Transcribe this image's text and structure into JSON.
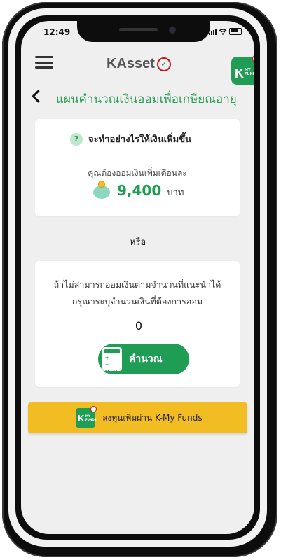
{
  "status_bar": {
    "time": "12:49"
  },
  "header": {
    "brand_name": "KAsset",
    "kmy_badge_text": "K",
    "kmy_badge_sub": "MY FUNDS"
  },
  "page": {
    "title": "แผนคำนวณเงินออมเพื่อเกษียณอายุ"
  },
  "result_card": {
    "question": "จะทำอย่างไรให้เงินเพิ่มขึ้น",
    "subtitle": "คุณต้องออมเงินเพิ่มเดือนละ",
    "amount": "9,400",
    "unit": "บาท"
  },
  "or_label": "หรือ",
  "custom_card": {
    "line1": "ถ้าไม่สามารถออมเงินตามจำนวนที่แนะนำได้",
    "line2": "กรุณาระบุจำนวนเงินที่ต้องการออม",
    "input_value": "0",
    "calculate_label": "คำนวณ"
  },
  "invest_bar": {
    "label": "ลงทุนเพิ่มผ่าน K-My Funds",
    "logo_text": "K",
    "logo_sub": "MY FUNDS"
  },
  "colors": {
    "accent_green": "#1f9d55",
    "title_green": "#2a9d57",
    "invest_yellow": "#f2bd22",
    "brand_red": "#c9141c"
  }
}
